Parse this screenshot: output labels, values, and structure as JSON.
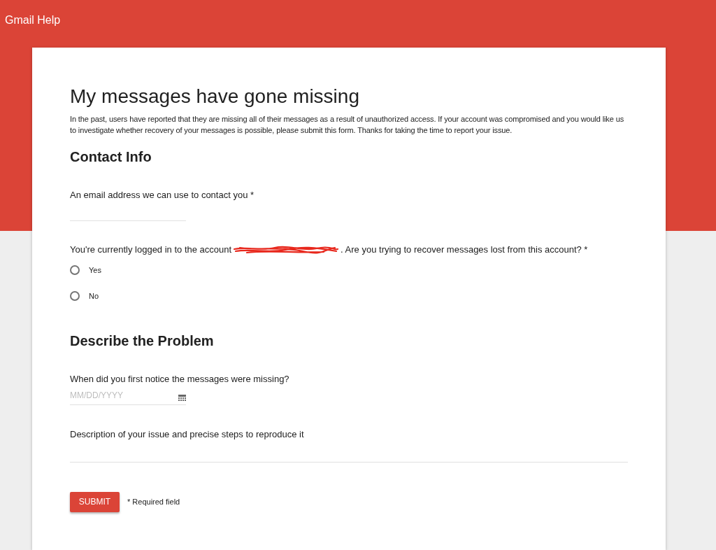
{
  "header": {
    "title": "Gmail Help"
  },
  "form": {
    "title": "My messages have gone missing",
    "intro": "In the past, users have reported that they are missing all of their messages as a result of unauthorized access. If your account was compromised and you would like us to investigate whether recovery of your messages is possible, please submit this form. Thanks for taking the time to report your issue.",
    "sections": [
      {
        "heading": "Contact Info",
        "fields": [
          {
            "kind": "text",
            "label": "An email address we can use to contact you *"
          },
          {
            "kind": "radio",
            "label_before": "You're currently logged in to the account",
            "account_redacted": true,
            "label_after": ". Are you trying to recover messages lost from this account? *",
            "options": [
              {
                "label": "Yes",
                "selected": false
              },
              {
                "label": "No",
                "selected": false
              }
            ]
          }
        ]
      },
      {
        "heading": "Describe the Problem",
        "fields": [
          {
            "kind": "date",
            "label": "When did you first notice the messages were missing?",
            "placeholder": "MM/DD/YYYY"
          },
          {
            "kind": "textarea",
            "label": "Description of your issue and precise steps to reproduce it"
          }
        ]
      }
    ],
    "submit": "SUBMIT",
    "required_note": "* Required field"
  }
}
